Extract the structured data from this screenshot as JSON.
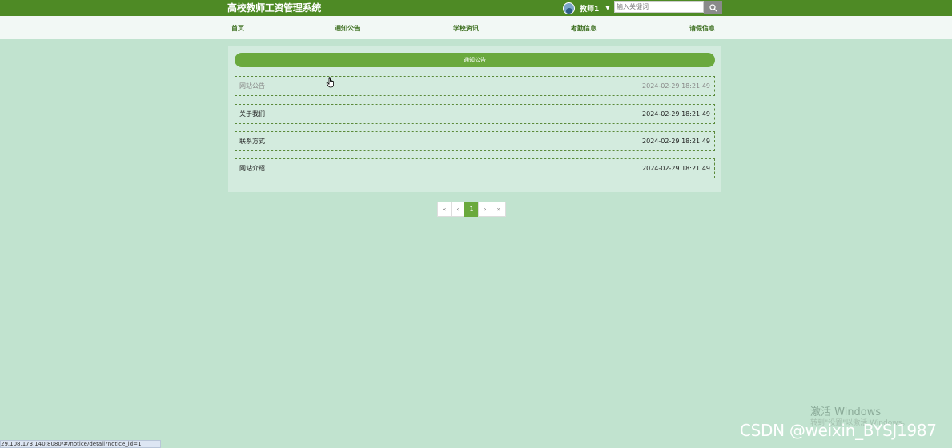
{
  "header": {
    "app_title": "高校教师工资管理系统",
    "user_name": "教师1",
    "search_placeholder": "输入关键词"
  },
  "nav": {
    "items": [
      "首页",
      "通知公告",
      "学校资讯",
      "考勤信息",
      "请假信息"
    ]
  },
  "panel": {
    "title": "通知公告",
    "rows": [
      {
        "title": "网站公告",
        "date": "2024-02-29 18:21:49"
      },
      {
        "title": "关于我们",
        "date": "2024-02-29 18:21:49"
      },
      {
        "title": "联系方式",
        "date": "2024-02-29 18:21:49"
      },
      {
        "title": "网站介绍",
        "date": "2024-02-29 18:21:49"
      }
    ]
  },
  "pagination": {
    "first": "«",
    "prev": "‹",
    "current": "1",
    "next": "›",
    "last": "»"
  },
  "overlay": {
    "activate_title": "激活 Windows",
    "activate_sub": "转到\"设置\"以激活 Windows。",
    "csdn_mark": "CSDN @weixin_BYSJ1987",
    "status_url": "29.108.173.140:8080/#/notice/detail?notice_id=1"
  },
  "icons": {
    "search": "search-icon",
    "cursor": "hand-pointer-icon",
    "caret": "caret-down-icon"
  },
  "colors": {
    "primary_green": "#4e8a25",
    "accent_green": "#6aa93d",
    "background": "#c1e3cf"
  }
}
